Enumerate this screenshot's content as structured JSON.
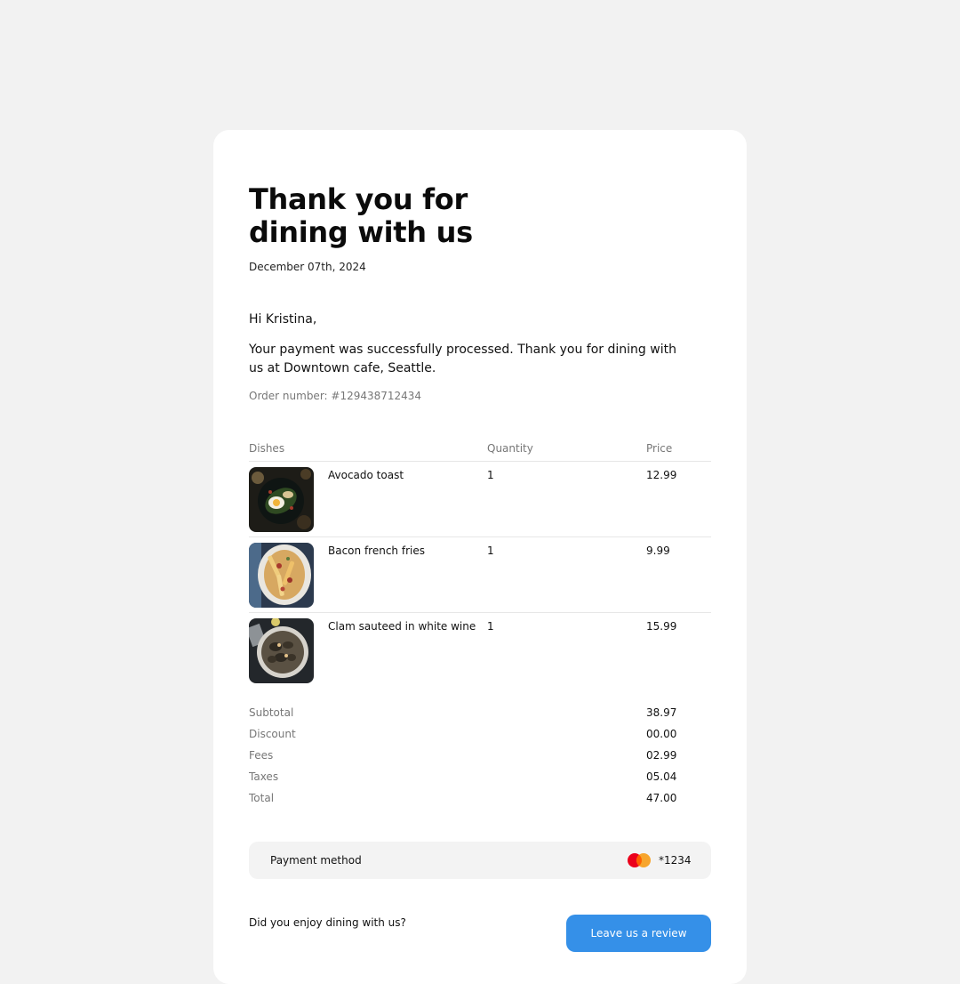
{
  "receipt": {
    "title_line1": "Thank you for",
    "title_line2": "dining with us",
    "date": "December 07th, 2024",
    "greeting": "Hi Kristina,",
    "message": "Your payment was successfully processed. Thank you for dining with us at Downtown cafe, Seattle.",
    "order_number": "Order number: #129438712434"
  },
  "table": {
    "headers": {
      "dishes": "Dishes",
      "quantity": "Quantity",
      "price": "Price"
    },
    "rows": [
      {
        "name": "Avocado toast",
        "quantity": "1",
        "price": "12.99",
        "image_icon": "avocado-toast-photo"
      },
      {
        "name": "Bacon french fries",
        "quantity": "1",
        "price": "9.99",
        "image_icon": "bacon-fries-photo"
      },
      {
        "name": "Clam sauteed in white wine",
        "quantity": "1",
        "price": "15.99",
        "image_icon": "clam-dish-photo"
      }
    ]
  },
  "summary": [
    {
      "label": "Subtotal",
      "value": "38.97"
    },
    {
      "label": "Discount",
      "value": "00.00"
    },
    {
      "label": "Fees",
      "value": "02.99"
    },
    {
      "label": "Taxes",
      "value": "05.04"
    },
    {
      "label": "Total",
      "value": "47.00"
    }
  ],
  "payment": {
    "label": "Payment method",
    "card_icon": "mastercard-icon",
    "card_last4": "*1234"
  },
  "footer": {
    "question": "Did you enjoy dining with us?",
    "review_button": "Leave us a review"
  },
  "colors": {
    "page_background": "#f2f2f2",
    "card_background": "#ffffff",
    "accent": "#3590e8",
    "muted_text": "#777777",
    "payment_background": "#f3f3f3",
    "mastercard_red": "#eb001b",
    "mastercard_orange": "#f79e1b"
  }
}
